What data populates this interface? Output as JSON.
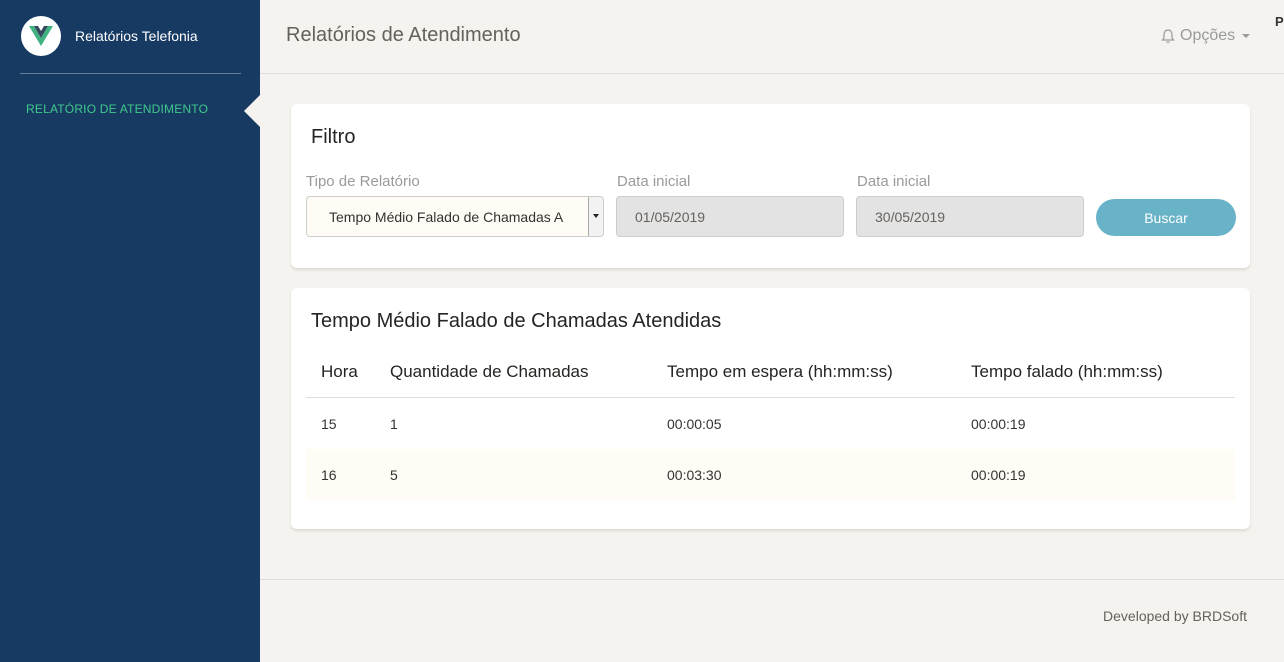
{
  "sidebar": {
    "brand_title": "Relatórios Telefonia",
    "nav_items": [
      {
        "label": "RELATÓRIO DE ATENDIMENTO",
        "active": true
      }
    ]
  },
  "header": {
    "title": "Relatórios de Atendimento",
    "options_label": "Opções",
    "edge_glyph": "P"
  },
  "filter": {
    "title": "Filtro",
    "report_type_label": "Tipo de Relatório",
    "report_type_value": "Tempo Médio Falado de Chamadas A",
    "start_date_label": "Data inicial",
    "start_date_value": "01/05/2019",
    "end_date_label": "Data inicial",
    "end_date_value": "30/05/2019",
    "search_button": "Buscar"
  },
  "report": {
    "title": "Tempo Médio Falado de Chamadas Atendidas",
    "columns": [
      "Hora",
      "Quantidade de Chamadas",
      "Tempo em espera (hh:mm:ss)",
      "Tempo falado (hh:mm:ss)"
    ],
    "rows": [
      [
        "15",
        "1",
        "00:00:05",
        "00:00:19"
      ],
      [
        "16",
        "5",
        "00:03:30",
        "00:00:19"
      ]
    ]
  },
  "footer": {
    "text": "Developed by BRDSoft"
  },
  "colors": {
    "sidebar_bg": "#173a63",
    "active_nav": "#3fc98b",
    "button": "#68b3c8",
    "page_bg": "#f4f3ef"
  },
  "icons": [
    "vue-logo-icon",
    "bell-icon",
    "caret-down-icon",
    "select-arrow-icon"
  ]
}
